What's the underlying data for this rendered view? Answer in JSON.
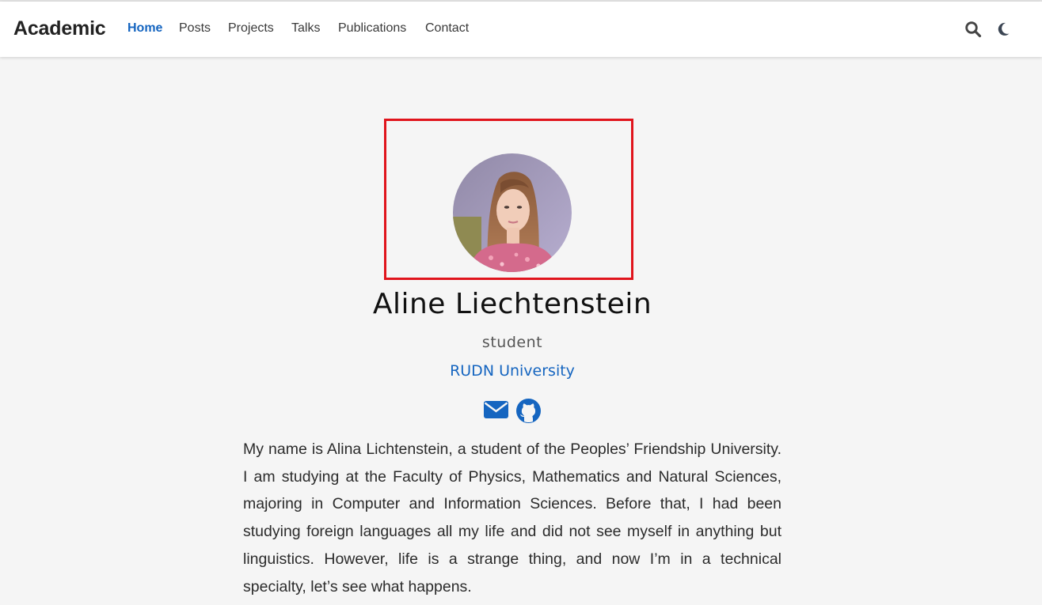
{
  "nav": {
    "brand": "Academic",
    "items": [
      {
        "label": "Home",
        "active": true
      },
      {
        "label": "Posts"
      },
      {
        "label": "Projects"
      },
      {
        "label": "Talks"
      },
      {
        "label": "Publications"
      },
      {
        "label": "Contact"
      }
    ],
    "icons": [
      "search-icon",
      "moon-icon"
    ]
  },
  "profile": {
    "name": "Aline Liechtenstein",
    "role": "student",
    "organization": "RUDN University",
    "social_icons": [
      "envelope-icon",
      "github-icon"
    ],
    "bio": "My name is Alina Lichtenstein, a student of the Peoples’ Friendship University. I am studying at the Faculty of Physics, Mathematics and Natural Sciences, majoring in Computer and Information Sciences. Before that, I had been studying foreign languages all my life and did not see myself in anything but linguistics. However, life is a strange thing, and now I’m in a technical specialty, let’s see what happens."
  },
  "colors": {
    "accent": "#1565c0",
    "highlight_box": "#e0141c",
    "background": "#f5f5f5"
  }
}
